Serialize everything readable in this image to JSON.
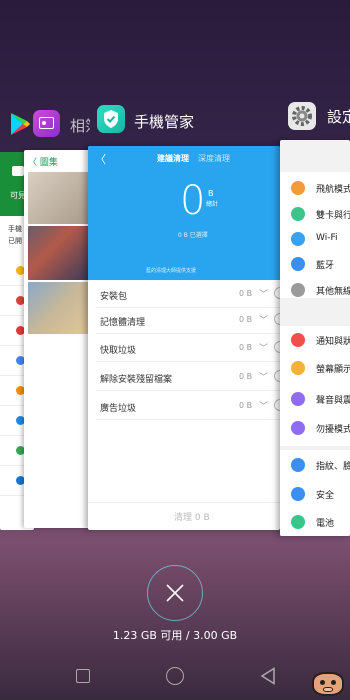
{
  "header": {
    "gallery_label_partial": "相簿",
    "manager_label": "手機管家",
    "settings_label_partial": "設定"
  },
  "cards": {
    "play_store": {
      "button_partial": "可見",
      "text_line1_partial": "手機",
      "text_line2_partial": "已開"
    },
    "gallery": {
      "back_label": "〈 圖集"
    },
    "manager": {
      "tab_active": "建議清理",
      "tab_inactive": "深度清理",
      "big_number": "0",
      "unit": "B",
      "unit_caption": "總計",
      "selected": "0 B 已選擇",
      "provider": "藍的清理大師提供支援",
      "rows": [
        {
          "label": "安裝包",
          "value": "0 B"
        },
        {
          "label": "記憶體清理",
          "value": "0 B"
        },
        {
          "label": "快取垃圾",
          "value": "0 B"
        },
        {
          "label": "解除安裝殘留檔案",
          "value": "0 B"
        },
        {
          "label": "廣告垃圾",
          "value": "0 B"
        }
      ],
      "clean_button": "清理 0 B"
    },
    "settings": {
      "group1": [
        {
          "label": "飛航模式",
          "color": "#f29b3b",
          "icon": "airplane-icon"
        },
        {
          "label": "雙卡與行",
          "color": "#3cc48a",
          "icon": "sim-icon"
        },
        {
          "label": "Wi-Fi",
          "color": "#3aa0f0",
          "icon": "wifi-icon"
        },
        {
          "label": "藍牙",
          "color": "#3a8ff0",
          "icon": "bluetooth-icon"
        },
        {
          "label": "其他無線",
          "color": "#9a9a9a",
          "icon": "more-icon"
        }
      ],
      "group2": [
        {
          "label": "通知與狀",
          "color": "#f0504a",
          "icon": "notification-icon"
        },
        {
          "label": "螢幕顯示",
          "color": "#f4b23a",
          "icon": "display-icon"
        },
        {
          "label": "聲音與震",
          "color": "#8f6cf0",
          "icon": "sound-icon"
        },
        {
          "label": "勿擾模式",
          "color": "#8f6cf0",
          "icon": "moon-icon"
        }
      ],
      "group3": [
        {
          "label": "指紋、臉",
          "color": "#3a8ff0",
          "icon": "fingerprint-icon"
        },
        {
          "label": "安全",
          "color": "#3a8ff0",
          "icon": "shield-icon"
        },
        {
          "label": "電池",
          "color": "#3cc48a",
          "icon": "battery-icon"
        }
      ]
    }
  },
  "memory": "1.23 GB 可用 / 3.00 GB",
  "colors": {
    "manager_blue": "#29a4ee",
    "close_ring": "#78c8dc"
  }
}
